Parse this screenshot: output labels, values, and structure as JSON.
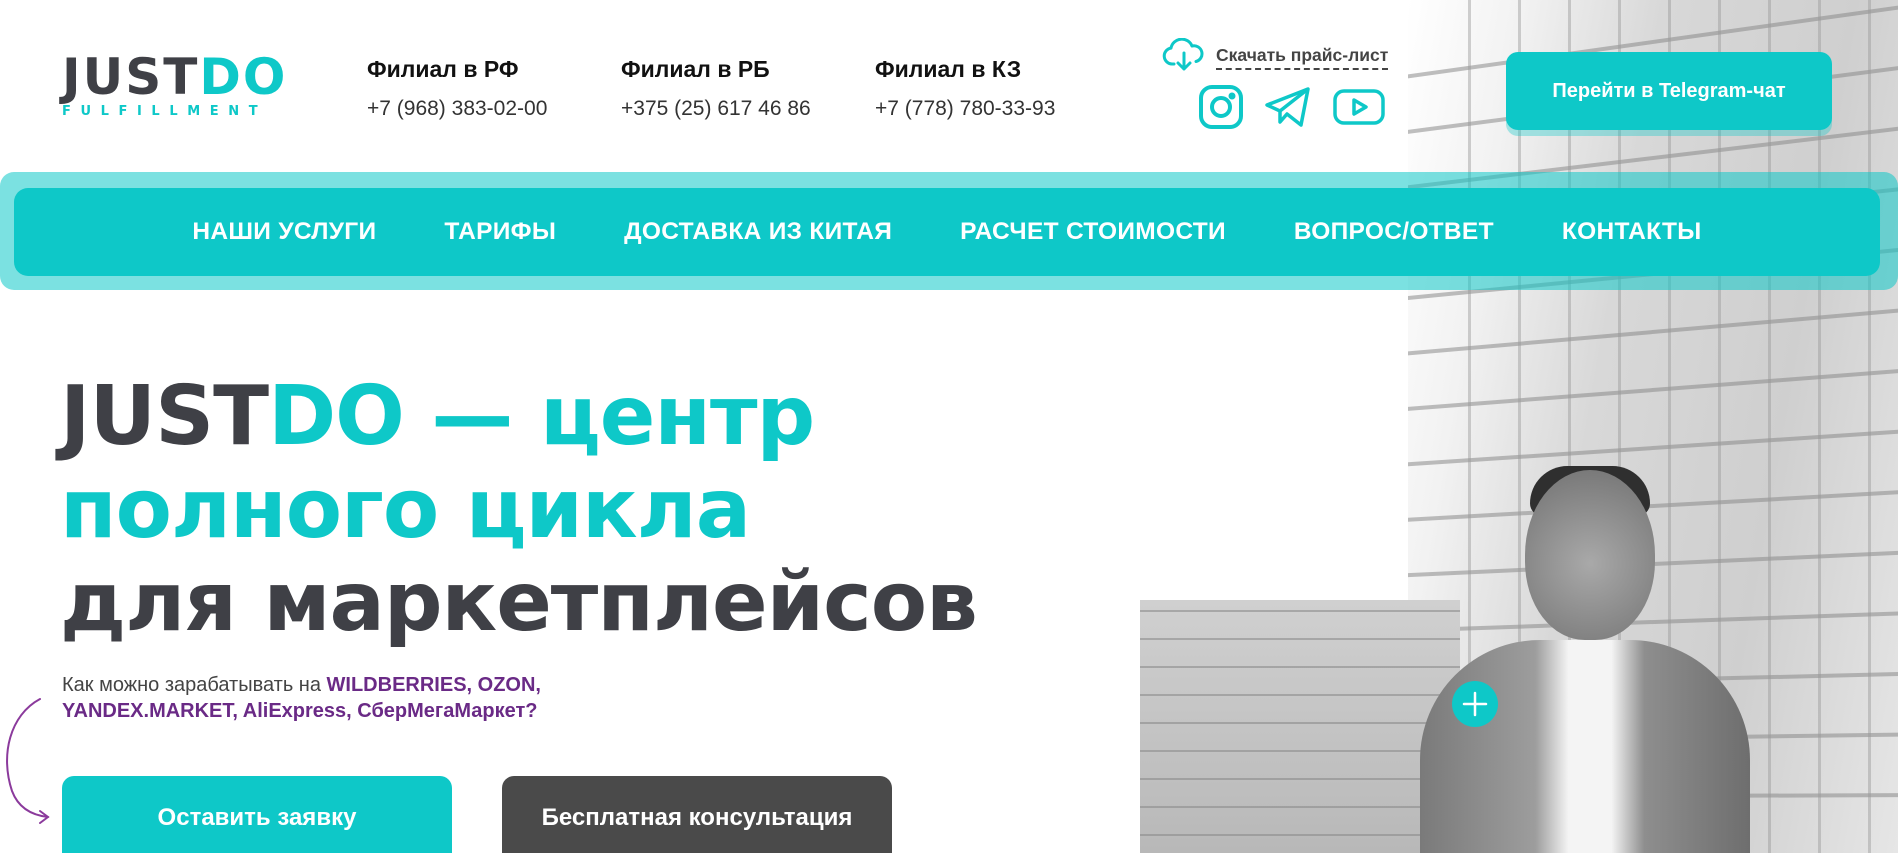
{
  "logo": {
    "main_dark": "JUST",
    "main_accent": "DO",
    "sub": "FULFILLMENT"
  },
  "branches": [
    {
      "title": "Филиал в РФ",
      "phone": "+7 (968) 383-02-00"
    },
    {
      "title": "Филиал в РБ",
      "phone": "+375 (25) 617 46 86"
    },
    {
      "title": "Филиал в КЗ",
      "phone": "+7 (778) 780-33-93"
    }
  ],
  "download": {
    "label": "Скачать прайс-лист",
    "icon": "cloud-download-icon"
  },
  "social": [
    {
      "name": "instagram-icon"
    },
    {
      "name": "telegram-icon"
    },
    {
      "name": "youtube-icon"
    }
  ],
  "telegram_button": {
    "label": "Перейти в Telegram-чат"
  },
  "nav": {
    "items": [
      {
        "label": "НАШИ УСЛУГИ"
      },
      {
        "label": "ТАРИФЫ"
      },
      {
        "label": "ДОСТАВКА ИЗ КИТАЯ"
      },
      {
        "label": "РАСЧЕТ СТОИМОСТИ"
      },
      {
        "label": "ВОПРОС/ОТВЕТ"
      },
      {
        "label": "КОНТАКТЫ"
      }
    ]
  },
  "hero": {
    "title_dark_1": "JUST",
    "title_teal_1": "DO — центр",
    "title_teal_2": "полного цикла",
    "title_dark_2": "для маркетплейсов",
    "subtitle_plain": "Как можно зарабатывать на ",
    "subtitle_accent_1": "WILDBERRIES, OZON,",
    "subtitle_accent_2": "YANDEX.MARKET, AliExpress, СберМегаМаркет?",
    "cta_primary": "Оставить заявку",
    "cta_secondary": "Бесплатная консультация"
  },
  "colors": {
    "accent": "#0ec8c8",
    "dark": "#3f4046",
    "purple": "#6a2a86",
    "secondary_button": "#4a4a4a"
  }
}
